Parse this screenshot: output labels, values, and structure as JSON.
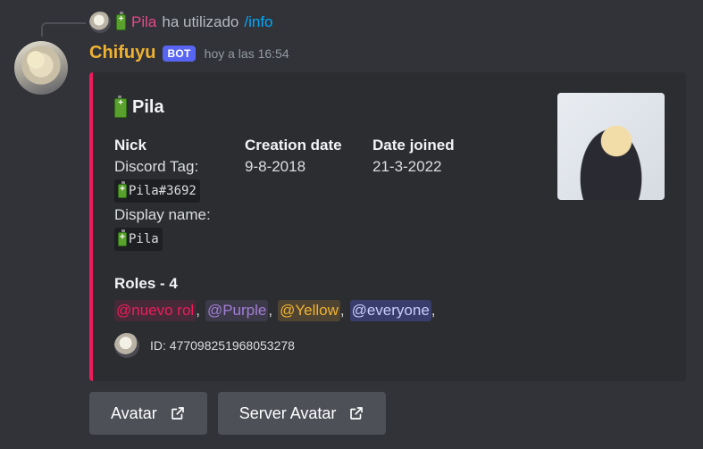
{
  "reply": {
    "user": "Pila",
    "text": "ha utilizado",
    "command": "/info"
  },
  "message": {
    "username": "Chifuyu",
    "bot_tag": "BOT",
    "timestamp": "hoy a las 16:54"
  },
  "embed": {
    "accent_color": "#ed1c5c",
    "title": "Pila",
    "fields": {
      "nick": {
        "name": "Nick",
        "discord_tag_label": "Discord Tag:",
        "discord_tag": "Pila#3692",
        "display_name_label": "Display name:",
        "display_name": "Pila"
      },
      "created": {
        "name": "Creation date",
        "value": "9-8-2018"
      },
      "joined": {
        "name": "Date joined",
        "value": "21-3-2022"
      }
    },
    "roles": {
      "name": "Roles - 4",
      "items": [
        {
          "label": "@nuevo rol",
          "color": "#ed1c5c"
        },
        {
          "label": "@Purple",
          "color": "#a37fd6"
        },
        {
          "label": "@Yellow",
          "color": "#f0b232"
        },
        {
          "label": "@everyone",
          "color": "#c9cdfb"
        }
      ]
    },
    "footer": "ID: 477098251968053278"
  },
  "buttons": [
    {
      "label": "Avatar",
      "icon": "external-link-icon"
    },
    {
      "label": "Server Avatar",
      "icon": "external-link-icon"
    }
  ]
}
